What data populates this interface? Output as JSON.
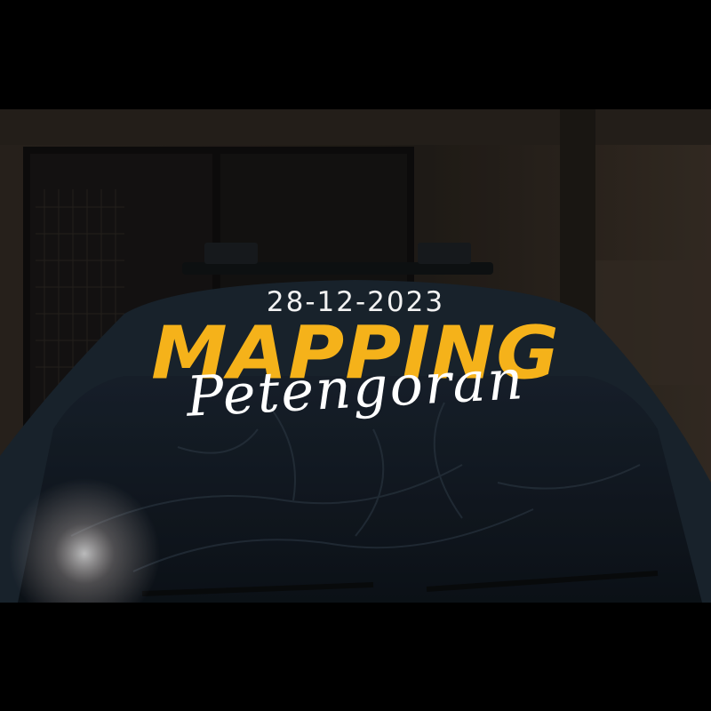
{
  "overlay": {
    "date": "28-12-2023",
    "title_main": "MAPPING",
    "title_script": "Petengoran"
  },
  "colors": {
    "title_main": "#f5b21a",
    "title_script": "#ffffff",
    "date": "#f2f2f2",
    "letterbox": "#000000",
    "wall": "#2a241d",
    "vehicle": "#1f2a36"
  }
}
